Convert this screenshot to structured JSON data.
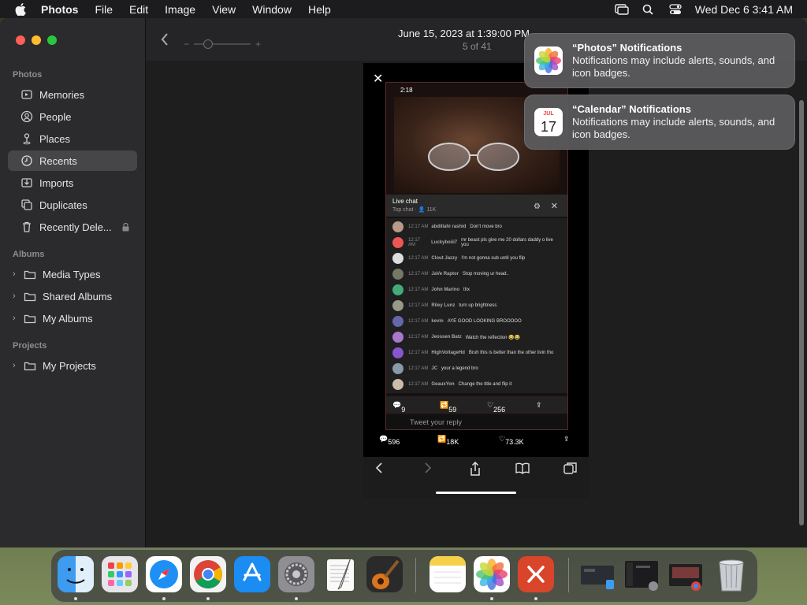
{
  "menubar": {
    "app_name": "Photos",
    "items": [
      "File",
      "Edit",
      "Image",
      "View",
      "Window",
      "Help"
    ],
    "clock": "Wed Dec 6  3:41 AM"
  },
  "sidebar": {
    "section_photos": "Photos",
    "photos_items": [
      "Memories",
      "People",
      "Places",
      "Recents",
      "Imports",
      "Duplicates",
      "Recently Dele..."
    ],
    "selected": "Recents",
    "section_albums": "Albums",
    "album_items": [
      "Media Types",
      "Shared Albums",
      "My Albums"
    ],
    "section_projects": "Projects",
    "project_items": [
      "My Projects"
    ]
  },
  "toolbar": {
    "photo_title": "June 15, 2023 at 1:39:00 PM",
    "photo_count": "5 of 41",
    "zoom_minus": "−",
    "zoom_plus": "+"
  },
  "photo": {
    "status_time": "2:18",
    "chat_title": "Live chat",
    "chat_sub": "Top chat",
    "chat_viewers": "11K",
    "messages": [
      {
        "time": "12:17 AM",
        "name": "abdillahi rashid",
        "text": "Don't move bro"
      },
      {
        "time": "12:17 AM",
        "name": "Luckyboiii7",
        "text": "mr beast pls give me 20 dollars daddy o live you"
      },
      {
        "time": "12:17 AM",
        "name": "Clout Jazzy",
        "text": "I'm not gonna sub until you flip"
      },
      {
        "time": "12:17 AM",
        "name": "JaVe Raptor",
        "text": "Stop moving ur head.."
      },
      {
        "time": "12:17 AM",
        "name": "John Marino",
        "text": "thx"
      },
      {
        "time": "12:17 AM",
        "name": "Riley Lunz",
        "text": "turn up brightness"
      },
      {
        "time": "12:17 AM",
        "name": "kevin",
        "text": "AYE GOOD LOOKING BROOOOO"
      },
      {
        "time": "12:17 AM",
        "name": "Jeossen Batz",
        "text": "Watch the reflection 😂😂"
      },
      {
        "time": "12:17 AM",
        "name": "HighVoltageHd",
        "text": "Bruh this is better than the other livin tho"
      },
      {
        "time": "12:17 AM",
        "name": "JC",
        "text": "your a legend bro"
      },
      {
        "time": "12:17 AM",
        "name": "GeauxYon",
        "text": "Change the title and flip it"
      }
    ],
    "inner_replies": "9",
    "inner_retweets": "59",
    "inner_likes": "256",
    "reply_placeholder": "Tweet your reply",
    "replies": "596",
    "retweets": "18K",
    "likes": "73.3K"
  },
  "notifications": [
    {
      "title": "“Photos” Notifications",
      "body": "Notifications may include alerts, sounds, and icon badges."
    },
    {
      "title": "“Calendar” Notifications",
      "body": "Notifications may include alerts, sounds, and icon badges.",
      "cal_month": "JUL",
      "cal_day": "17"
    }
  ],
  "dock": {
    "apps": [
      "finder-icon",
      "launchpad-icon",
      "safari-icon",
      "chrome-icon",
      "app-store-icon",
      "system-settings-icon",
      "textedit-icon",
      "garageband-icon",
      "notes-icon",
      "photos-icon",
      "remote-desktop-icon",
      "recent-window-1",
      "recent-window-2",
      "recent-window-3",
      "trash-icon"
    ]
  }
}
